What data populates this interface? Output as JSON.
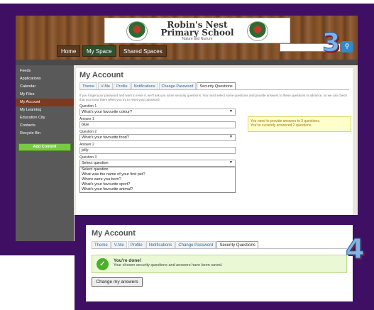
{
  "header": {
    "school_name": "Robin's Nest\nPrimary School",
    "motto": "Nature and Nurture",
    "nav_tabs": [
      "Home",
      "My Space",
      "Shared Spaces"
    ],
    "step_a": "3",
    "step_b": "4"
  },
  "sidebar": {
    "items": [
      "Feeds",
      "Applications",
      "Calendar",
      "My Files",
      "My Account",
      "My Learning",
      "Education City",
      "Contacts",
      "Recycle Bin"
    ],
    "active_index": 4,
    "add_content": "Add Content"
  },
  "account": {
    "title": "My Account",
    "tabs": [
      "Theme",
      "V-Me",
      "Profile",
      "Notifications",
      "Change Password",
      "Security Questions"
    ],
    "active_tab": 5,
    "intro": "If you forget your password and want to reset it, we'll ask you some security questions. You must select some questions and provide answers to these questions in advance, so we can check that you know them when you try to reset your password.",
    "notice_line1": "You need to provide answers to 3 questions.",
    "notice_line2": "You've currently answered 2 questions.",
    "q1_label": "Question 1",
    "q1_value": "What's your favourite colour?",
    "a1_label": "Answer 1",
    "a1_value": "blue",
    "q2_label": "Question 2",
    "q2_value": "What's your favourite food?",
    "a2_label": "Answer 2",
    "a2_value": "jelly",
    "q3_label": "Question 3",
    "q3_value": "Select question",
    "q3_options": [
      "Select question",
      "What was the name of your first pet?",
      "Where were you born?",
      "What's your favourite sport?",
      "What's your favourite animal?"
    ]
  },
  "result": {
    "title": "My Account",
    "tabs": [
      "Theme",
      "V-Me",
      "Profile",
      "Notifications",
      "Change Password",
      "Security Questions"
    ],
    "success_title": "You're done!",
    "success_text": "Your chosen security questions and answers have been saved.",
    "change_button": "Change my answers"
  },
  "colors": {
    "frame": "#3f0f63",
    "success_bg": "#eaf8d6",
    "notice_bg": "#ffffcc"
  }
}
